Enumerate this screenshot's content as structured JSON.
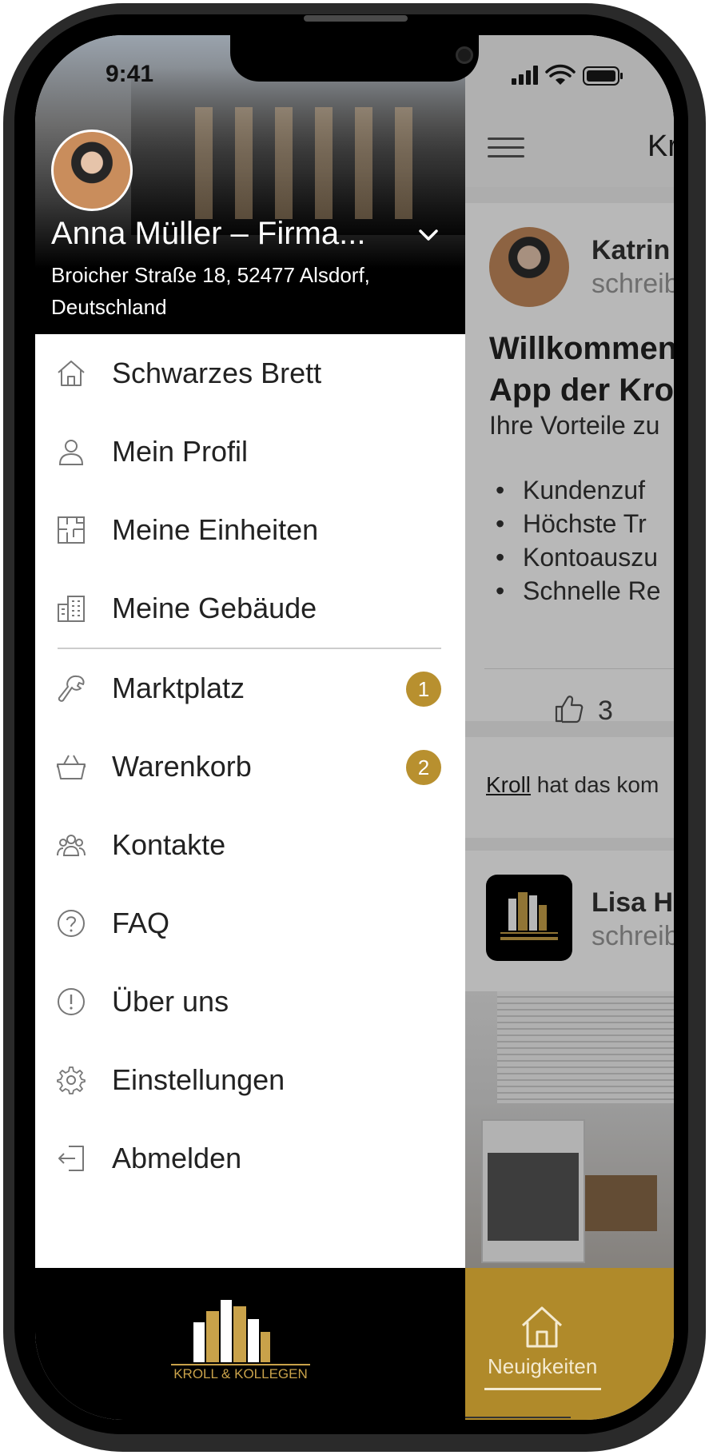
{
  "status_bar": {
    "time": "9:41"
  },
  "profile": {
    "name": "Anna Müller – Firma...",
    "address": "Broicher Straße 18, 52477 Alsdorf, Deutschland"
  },
  "menu": {
    "items": [
      {
        "label": "Schwarzes Brett",
        "icon": "house-icon"
      },
      {
        "label": "Mein Profil",
        "icon": "user-icon"
      },
      {
        "label": "Meine Einheiten",
        "icon": "floorplan-icon"
      },
      {
        "label": "Meine Gebäude",
        "icon": "building-icon"
      }
    ],
    "items2": [
      {
        "label": "Marktplatz",
        "icon": "wrench-icon",
        "badge": "1"
      },
      {
        "label": "Warenkorb",
        "icon": "basket-icon",
        "badge": "2"
      },
      {
        "label": "Kontakte",
        "icon": "contacts-icon"
      },
      {
        "label": "FAQ",
        "icon": "question-icon"
      },
      {
        "label": "Über uns",
        "icon": "info-icon"
      },
      {
        "label": "Einstellungen",
        "icon": "gear-icon"
      },
      {
        "label": "Abmelden",
        "icon": "logout-icon"
      }
    ]
  },
  "footer": {
    "logo_text": "KROLL & KOLLEGEN"
  },
  "background_app": {
    "title": "Kr",
    "post1": {
      "author": "Katrin",
      "subtitle": "schreib",
      "title_line1": "Willkommen",
      "title_line2": "App der Kro",
      "lead": "Ihre Vorteile zu",
      "bullets": [
        "Kundenzuf",
        "Höchste Tr",
        "Kontoauszu",
        "Schnelle Re"
      ],
      "likes": "3"
    },
    "activity": {
      "link": "Kroll",
      "text": " hat das kom"
    },
    "post2": {
      "author": "Lisa H",
      "subtitle": "schreib"
    },
    "tab": {
      "label": "Neuigkeiten"
    }
  },
  "colors": {
    "accent_gold": "#b8902f",
    "tabbar_gold": "#b08a2a"
  }
}
